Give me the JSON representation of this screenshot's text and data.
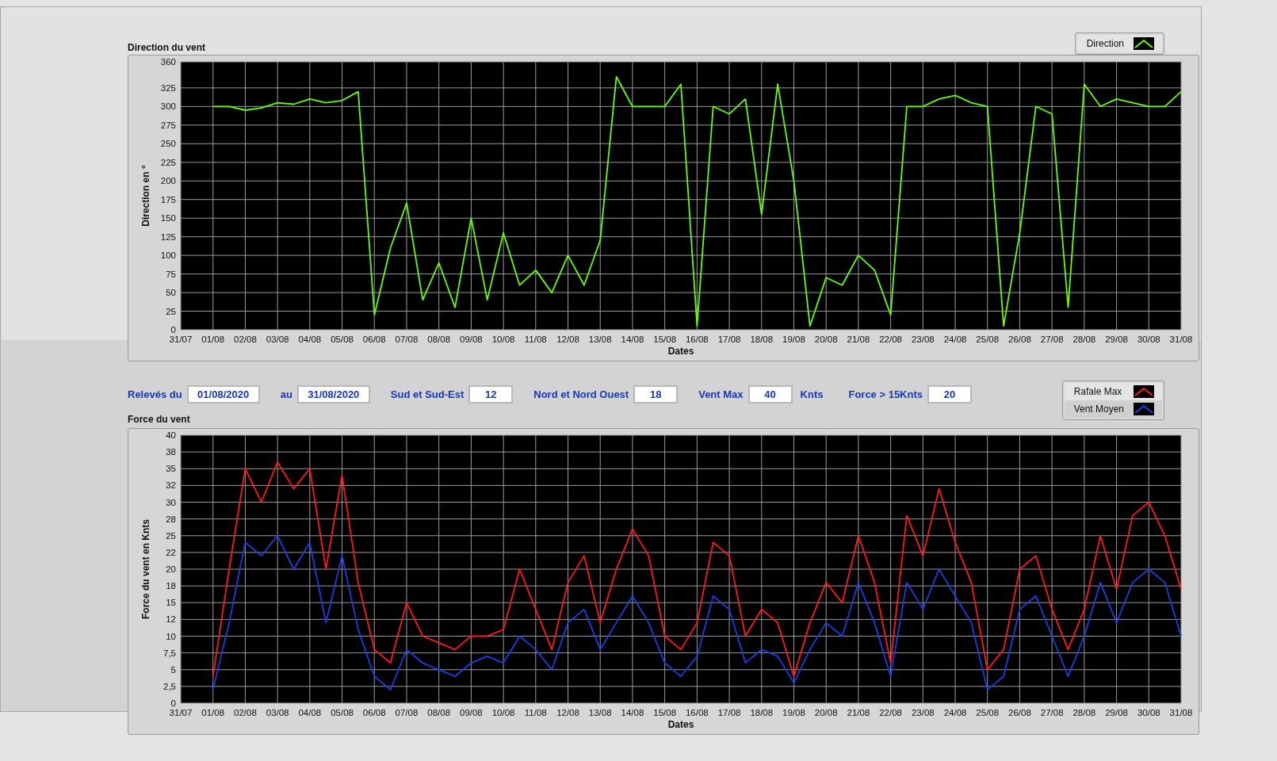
{
  "direction_chart": {
    "title": "Direction du vent",
    "chart_data": {
      "type": "line",
      "xlabel": "Dates",
      "ylabel": "Direction en °",
      "ylim": [
        0,
        360
      ],
      "grid": true,
      "categories": [
        "31/07",
        null,
        "01/08",
        null,
        "02/08",
        null,
        "03/08",
        null,
        "04/08",
        null,
        "05/08",
        null,
        "06/08",
        null,
        "07/08",
        null,
        "08/08",
        null,
        "09/08",
        null,
        "10/08",
        null,
        "11/08",
        null,
        "12/08",
        null,
        "13/08",
        null,
        "14/08",
        null,
        "15/08",
        null,
        "16/08",
        null,
        "17/08",
        null,
        "18/08",
        null,
        "19/08",
        null,
        "20/08",
        null,
        "21/08",
        null,
        "22/08",
        null,
        "23/08",
        null,
        "24/08",
        null,
        "25/08",
        null,
        "26/08",
        null,
        "27/08",
        null,
        "28/08",
        null,
        "29/08",
        null,
        "30/08",
        null,
        "31/08"
      ],
      "series": [
        {
          "name": "Direction",
          "color": "#66ff00",
          "values": [
            null,
            null,
            300,
            300,
            295,
            298,
            305,
            303,
            310,
            305,
            308,
            320,
            20,
            110,
            170,
            40,
            90,
            30,
            150,
            40,
            130,
            60,
            80,
            50,
            100,
            60,
            120,
            340,
            300,
            300,
            300,
            330,
            5,
            300,
            290,
            310,
            155,
            330,
            200,
            5,
            70,
            60,
            100,
            80,
            20,
            300,
            300,
            310,
            315,
            305,
            300,
            5,
            130,
            300,
            290,
            30,
            330,
            300,
            310,
            305,
            300,
            300,
            320
          ]
        }
      ],
      "yticks": [
        0,
        25,
        50,
        75,
        100,
        125,
        150,
        175,
        200,
        225,
        250,
        275,
        300,
        325,
        360
      ]
    }
  },
  "controls": [
    {
      "label": "Relevés du",
      "value": "01/08/2020"
    },
    {
      "label": "au",
      "value": "31/08/2020"
    },
    {
      "label": "Sud et Sud-Est",
      "value": "12"
    },
    {
      "label": "Nord et Nord Ouest",
      "value": "18"
    },
    {
      "label": "Vent Max",
      "value": "40",
      "unit": "Knts"
    },
    {
      "label": "Force > 15Knts",
      "value": "20"
    }
  ],
  "force_chart": {
    "title": "Force du vent",
    "chart_data": {
      "type": "line",
      "xlabel": "Dates",
      "ylabel": "Force du vent en Knts",
      "ylim": [
        0,
        40
      ],
      "grid": true,
      "categories": [
        "31/07",
        null,
        "01/08",
        null,
        "02/08",
        null,
        "03/08",
        null,
        "04/08",
        null,
        "05/08",
        null,
        "06/08",
        null,
        "07/08",
        null,
        "08/08",
        null,
        "09/08",
        null,
        "10/08",
        null,
        "11/08",
        null,
        "12/08",
        null,
        "13/08",
        null,
        "14/08",
        null,
        "15/08",
        null,
        "16/08",
        null,
        "17/08",
        null,
        "18/08",
        null,
        "19/08",
        null,
        "20/08",
        null,
        "21/08",
        null,
        "22/08",
        null,
        "23/08",
        null,
        "24/08",
        null,
        "25/08",
        null,
        "26/08",
        null,
        "27/08",
        null,
        "28/08",
        null,
        "29/08",
        null,
        "30/08",
        null,
        "31/08"
      ],
      "series": [
        {
          "name": "Rafale Max",
          "color": "#ff1a1a",
          "values": [
            null,
            null,
            4,
            20,
            35,
            30,
            36,
            32,
            35,
            20,
            34,
            18,
            8,
            6,
            15,
            10,
            9,
            8,
            10,
            10,
            11,
            20,
            14,
            8,
            18,
            22,
            12,
            20,
            26,
            22,
            10,
            8,
            12,
            24,
            22,
            10,
            14,
            12,
            4,
            12,
            18,
            15,
            25,
            18,
            6,
            28,
            22,
            32,
            24,
            18,
            5,
            8,
            20,
            22,
            14,
            8,
            14,
            25,
            17,
            28,
            30,
            25,
            17
          ]
        },
        {
          "name": "Vent Moyen",
          "color": "#1a3fe0",
          "values": [
            null,
            null,
            2,
            12,
            24,
            22,
            25,
            20,
            24,
            12,
            22,
            11,
            4,
            2,
            8,
            6,
            5,
            4,
            6,
            7,
            6,
            10,
            8,
            5,
            12,
            14,
            8,
            12,
            16,
            12,
            6,
            4,
            7,
            16,
            14,
            6,
            8,
            7,
            3,
            8,
            12,
            10,
            18,
            12,
            4,
            18,
            14,
            20,
            16,
            12,
            2,
            4,
            14,
            16,
            10,
            4,
            10,
            18,
            12,
            18,
            20,
            18,
            10
          ]
        }
      ],
      "yticks": [
        0,
        {
          "value": 2.5,
          "label": "2,5"
        },
        5,
        {
          "value": 7.5,
          "label": "7,5"
        },
        10,
        {
          "value": 12.5,
          "label": "12"
        },
        15,
        {
          "value": 17.5,
          "label": "18"
        },
        20,
        {
          "value": 22.5,
          "label": "22"
        },
        25,
        {
          "value": 27.5,
          "label": "28"
        },
        30,
        {
          "value": 32.5,
          "label": "32"
        },
        35,
        {
          "value": 37.5,
          "label": "38"
        },
        40
      ]
    }
  }
}
